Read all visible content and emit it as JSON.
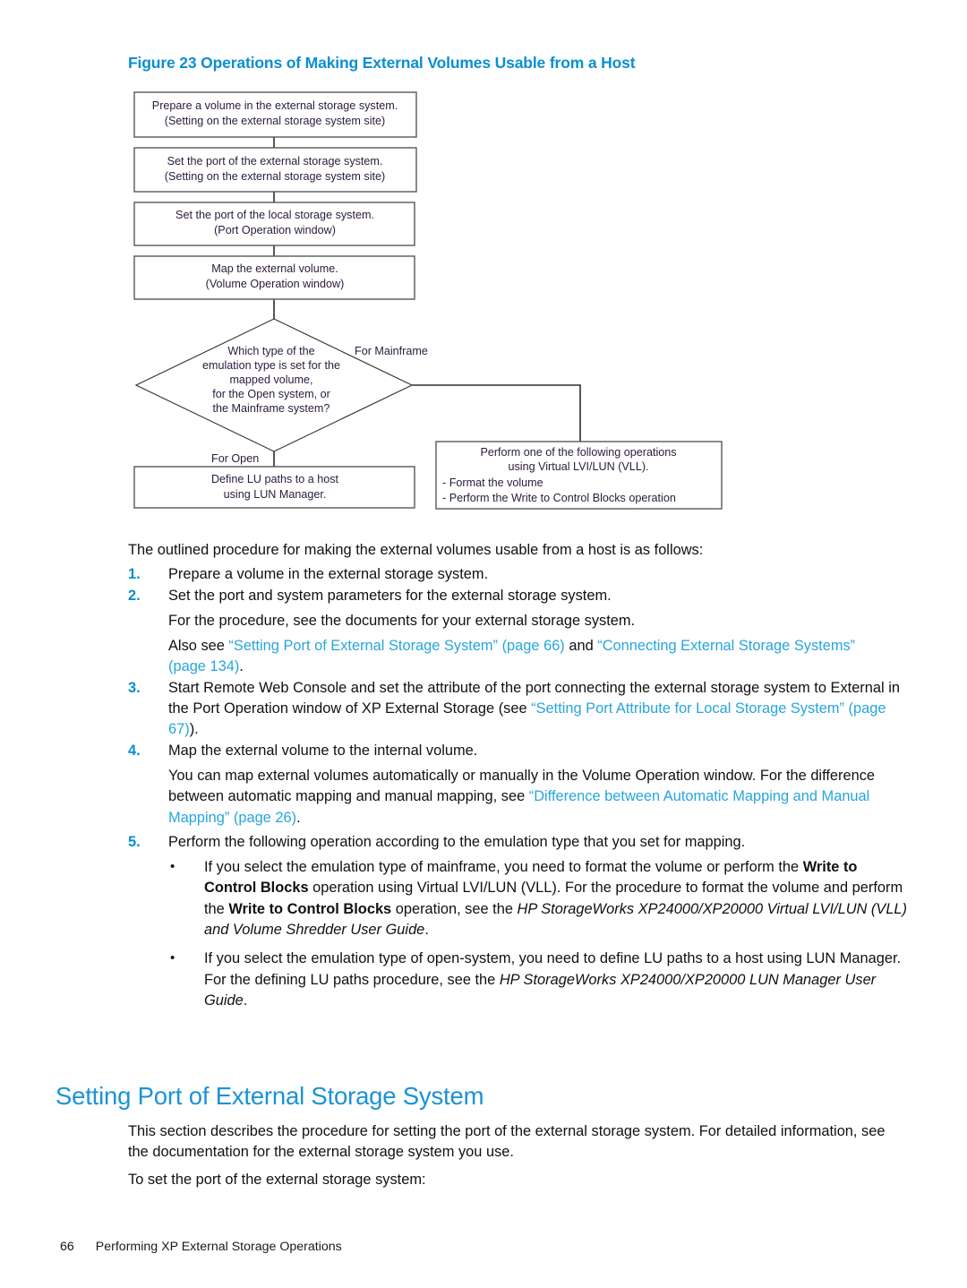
{
  "figure": {
    "caption": "Figure 23 Operations of Making External Volumes Usable from a Host",
    "boxes": [
      {
        "id": "prepare-volume",
        "lines": [
          "Prepare a volume in the external storage system.",
          "(Setting on the external storage system site)"
        ]
      },
      {
        "id": "set-external-port",
        "lines": [
          "Set the port of the external storage system.",
          "(Setting on the external storage system site)"
        ]
      },
      {
        "id": "set-local-port",
        "lines": [
          "Set the port of the local storage system.",
          "(Port Operation window)"
        ]
      },
      {
        "id": "map-external-volume",
        "lines": [
          "Map the external volume.",
          "(Volume Operation window)"
        ]
      },
      {
        "id": "define-lu-paths",
        "lines": [
          "Define LU paths to a host",
          "using LUN Manager."
        ]
      },
      {
        "id": "perform-vll-operations",
        "lines": [
          "Perform one of the following operations",
          "using Virtual LVI/LUN (VLL).",
          "- Format the volume",
          "- Perform the Write to Control Blocks operation"
        ]
      }
    ],
    "decision": {
      "id": "emulation-type-decision",
      "lines": [
        "Which type of the",
        "emulation type is set for the",
        "mapped volume,",
        "for the Open system, or",
        "the Mainframe system?"
      ]
    },
    "branch_labels": {
      "mainframe": "For Mainframe",
      "open": "For Open"
    }
  },
  "body": {
    "lead": "The outlined procedure for making the external volumes usable from a host is as follows:",
    "steps": [
      {
        "number": "1.",
        "text": "Prepare a volume in the external storage system."
      },
      {
        "number": "2.",
        "text": "Set the port and system parameters for the external storage system."
      },
      {
        "number": "3.",
        "text": "Start Remote Web Console and set the attribute of the port connecting the external storage system to External in the Port Operation window of XP External Storage (see "
      },
      {
        "number": "4.",
        "text": "Map the external volume to the internal volume."
      },
      {
        "number": "5.",
        "text": "Perform the following operation according to the emulation type that you set for mapping."
      }
    ],
    "step2_sub1": "For the procedure, see the documents for your external storage system.",
    "step2_sub2_prefix": "Also see ",
    "step2_link1": "“Setting Port of External Storage System” (page 66)",
    "step2_sub2_mid": " and ",
    "step2_link2": "“Connecting External Storage Systems” (page 134)",
    "step2_sub2_suffix": ".",
    "step3_link": "“Setting Port Attribute for Local Storage System” (page 67)",
    "step3_suffix": ").",
    "step4_sub_prefix": "You can map external volumes automatically or manually in the Volume Operation window. For the difference between automatic mapping and manual mapping, see ",
    "step4_link": "“Difference between Automatic Mapping and Manual Mapping” (page 26)",
    "step4_sub_suffix": ".",
    "bullets": [
      {
        "p1": "If you select the emulation type of mainframe, you need to format the volume or perform the ",
        "b1": "Write to Control Blocks",
        "p2": " operation using Virtual LVI/LUN (VLL). For the procedure to format the volume and perform the ",
        "b2": "Write to Control Blocks",
        "p3": " operation, see the ",
        "i1": "HP StorageWorks XP24000/XP20000 Virtual LVI/LUN (VLL) and Volume Shredder User Guide",
        "p4": "."
      },
      {
        "p1": "If you select the emulation type of open-system, you need to define LU paths to a host using LUN Manager. For the defining LU paths procedure, see the ",
        "i1": "HP StorageWorks XP24000/XP20000 LUN Manager User Guide",
        "p4": "."
      }
    ]
  },
  "section": {
    "heading": "Setting Port of External Storage System",
    "paragraph1": "This section describes the procedure for setting the port of the external storage system. For detailed information, see the documentation for the external storage system you use.",
    "paragraph2": "To set the port of the external storage system:"
  },
  "footer": {
    "page_number": "66",
    "chapter_title": "Performing XP External Storage Operations"
  },
  "colors": {
    "hp_blue": "#0b8fd1",
    "link_blue": "#27a5dd",
    "heading_blue": "#1a93d4",
    "flow_text": "#2b1a3d",
    "flow_border": "#58585b"
  }
}
